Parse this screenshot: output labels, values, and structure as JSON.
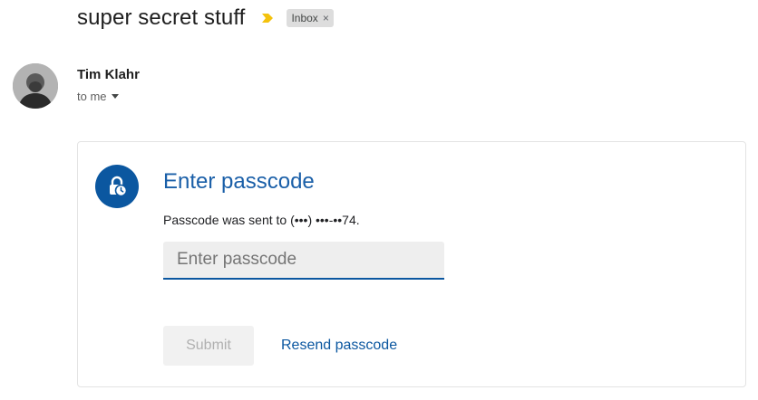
{
  "email": {
    "subject": "super secret stuff",
    "importance_icon": "importance-marker-icon",
    "label": {
      "text": "Inbox",
      "close": "×"
    },
    "sender": {
      "name": "Tim Klahr",
      "recipient": "to me",
      "avatar_icon": "avatar"
    }
  },
  "passcode_card": {
    "icon": "lock-clock-icon",
    "title": "Enter passcode",
    "description": "Passcode was sent to (•••) •••-••74.",
    "input": {
      "placeholder": "Enter passcode",
      "value": ""
    },
    "submit_label": "Submit",
    "resend_label": "Resend passcode"
  },
  "colors": {
    "accent": "#0b57a0",
    "importance": "#f4c20d",
    "disabled_button_bg": "#f1f1f1",
    "disabled_button_text": "#b0b0b0"
  }
}
